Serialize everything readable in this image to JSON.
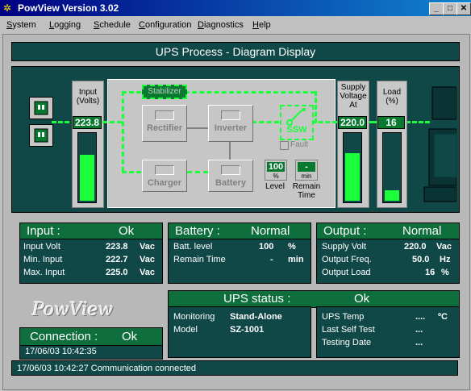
{
  "window": {
    "title": "PowView Version 3.02",
    "buttons": [
      "_",
      "□",
      "✕"
    ]
  },
  "menu": [
    "System",
    "Logging",
    "Schedule",
    "Configuration",
    "Diagnostics",
    "Help"
  ],
  "header": {
    "title": "UPS Process - Diagram Display"
  },
  "diagram": {
    "input": {
      "label_line1": "Input",
      "label_line2": "(Volts)",
      "value": "223.8",
      "gauge_fraction": 0.7
    },
    "supply": {
      "label_line1": "Supply",
      "label_line2": "Voltage",
      "label_line3": "At",
      "value": "220.0",
      "gauge_fraction": 0.72
    },
    "load": {
      "label_line1": "Load",
      "label_line2": "(%)",
      "value": "16",
      "gauge_fraction": 0.16
    },
    "blocks": {
      "stabilizer": "Stabilizer",
      "rectifier": "Rectifier",
      "inverter": "Inverter",
      "charger": "Charger",
      "battery": "Battery",
      "ssw": "SSW"
    },
    "fault_label": "Fault",
    "level": {
      "value": "100",
      "unit": "%",
      "label": "Level"
    },
    "remain": {
      "value": "-",
      "unit": "min",
      "label1": "Remain",
      "label2": "Time"
    }
  },
  "input_panel": {
    "title": "Input :",
    "status": "Ok",
    "rows": [
      {
        "label": "Input Volt",
        "value": "223.8",
        "unit": "Vac"
      },
      {
        "label": "Min. Input",
        "value": "222.7",
        "unit": "Vac"
      },
      {
        "label": "Max. Input",
        "value": "225.0",
        "unit": "Vac"
      }
    ]
  },
  "battery_panel": {
    "title": "Battery :",
    "status": "Normal",
    "rows": [
      {
        "label": "Batt. level",
        "value": "100",
        "unit": "%"
      },
      {
        "label": "Remain Time",
        "value": "-",
        "unit": "min"
      }
    ]
  },
  "output_panel": {
    "title": "Output :",
    "status": "Normal",
    "rows": [
      {
        "label": "Supply Volt",
        "value": "220.0",
        "unit": "Vac"
      },
      {
        "label": "Output Freq.",
        "value": "50.0",
        "unit": "Hz"
      },
      {
        "label": "Output Load",
        "value": "16",
        "unit": "%"
      }
    ]
  },
  "logo": "PowView",
  "connection": {
    "title": "Connection :",
    "status": "Ok",
    "timestamp": "17/06/03 10:42:35"
  },
  "ups_status": {
    "title": "UPS status :",
    "status": "Ok",
    "monitoring_label": "Monitoring",
    "monitoring_value": "Stand-Alone",
    "model_label": "Model",
    "model_value": "SZ-1001",
    "temp_label": "UPS Temp",
    "temp_value": "....",
    "temp_unit": "ºC",
    "selftest_label": "Last Self Test",
    "selftest_value": "...",
    "testing_label": "Testing Date",
    "testing_value": "..."
  },
  "statusbar": {
    "text": "17/06/03 10:42:27 Communication connected"
  },
  "colors": {
    "teal": "#104848",
    "green_header": "#0e6e3c",
    "accent_green": "#1aff3a"
  }
}
